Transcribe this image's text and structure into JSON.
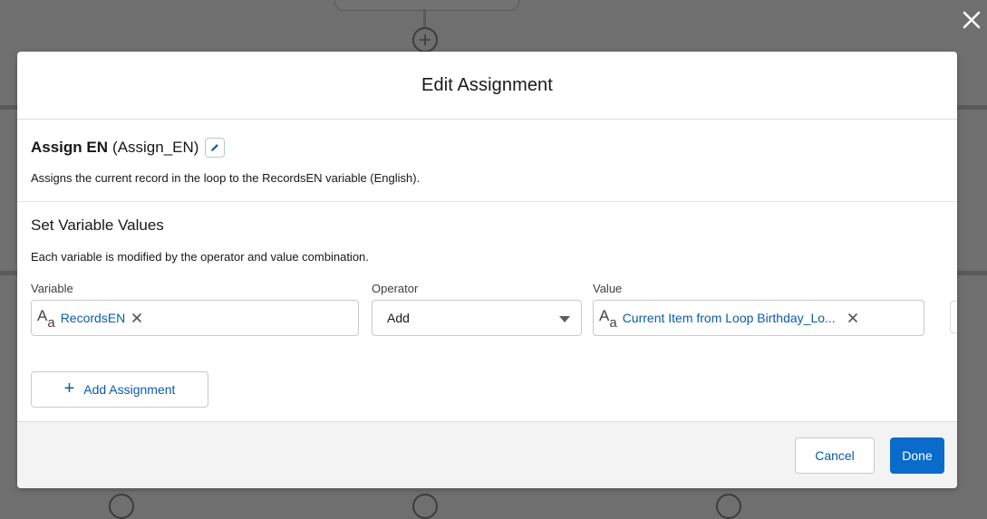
{
  "modal": {
    "title": "Edit Assignment",
    "element_label": "Assign EN",
    "element_api_name": "(Assign_EN)",
    "description": "Assigns the current record in the loop to the RecordsEN variable (English).",
    "section_title": "Set Variable Values",
    "section_description": "Each variable is modified by the operator and value combination."
  },
  "columns": {
    "variable": "Variable",
    "operator": "Operator",
    "value": "Value"
  },
  "row": {
    "variable_icon": "A",
    "variable_icon_sub": "a",
    "variable": "RecordsEN",
    "operator": "Add",
    "value_icon": "A",
    "value_icon_sub": "a",
    "value": "Current Item from Loop Birthday_Lo..."
  },
  "buttons": {
    "add_assignment": "Add Assignment",
    "cancel": "Cancel",
    "done": "Done"
  },
  "icons": {
    "close": "close-icon",
    "edit": "pencil-icon",
    "trash": "trash-icon",
    "plus": "plus-icon"
  },
  "colors": {
    "brand": "#0b6bcb",
    "link": "#0b5cab",
    "overlay": "#6f6f6f"
  }
}
